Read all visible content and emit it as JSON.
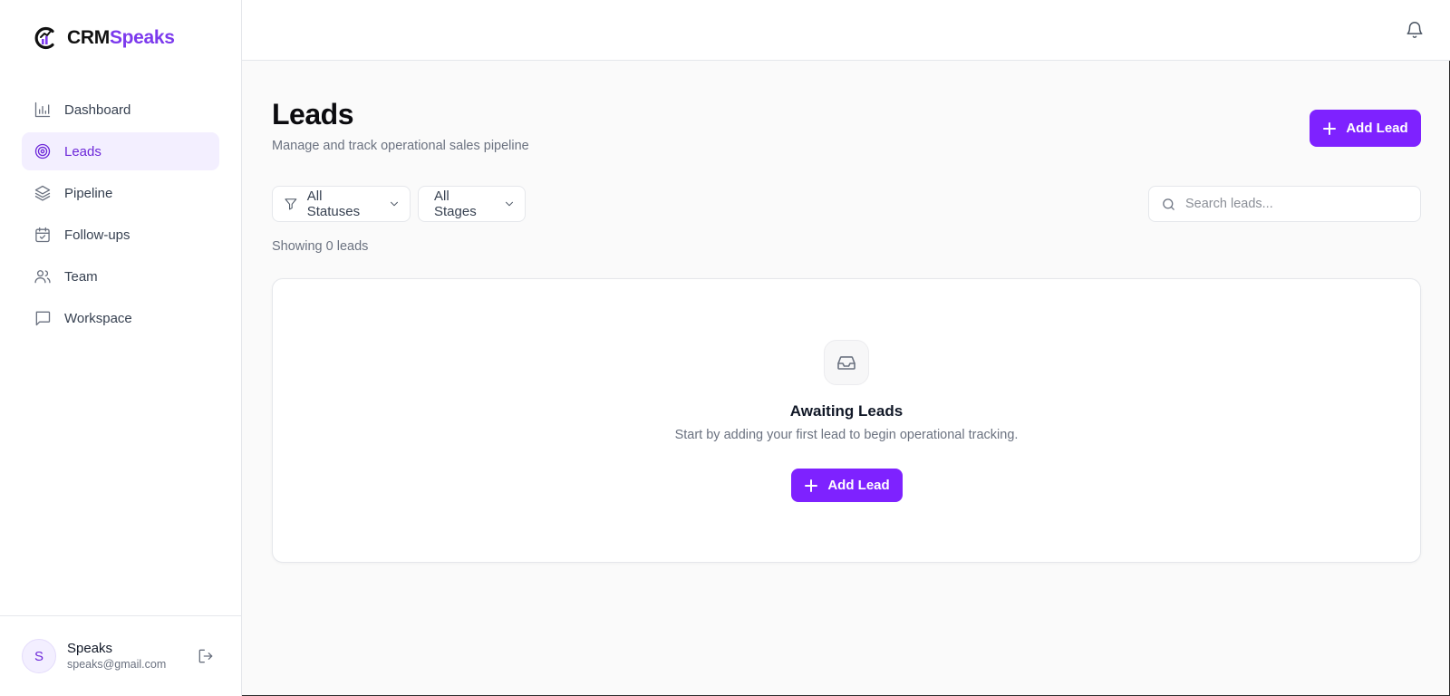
{
  "brand": {
    "name_part1": "CRM",
    "name_part2": "Speaks",
    "accent": "#7c3aed"
  },
  "nav": {
    "items": [
      {
        "label": "Dashboard",
        "icon": "bar-chart-icon",
        "active": false
      },
      {
        "label": "Leads",
        "icon": "target-icon",
        "active": true
      },
      {
        "label": "Pipeline",
        "icon": "layers-icon",
        "active": false
      },
      {
        "label": "Follow-ups",
        "icon": "calendar-check-icon",
        "active": false
      },
      {
        "label": "Team",
        "icon": "users-icon",
        "active": false
      },
      {
        "label": "Workspace",
        "icon": "message-square-icon",
        "active": false
      }
    ]
  },
  "user": {
    "initial": "S",
    "name": "Speaks",
    "email": "speaks@gmail.com"
  },
  "topbar": {
    "notification_icon": "bell-icon"
  },
  "page": {
    "title": "Leads",
    "subtitle": "Manage and track operational sales pipeline",
    "add_button": "Add Lead"
  },
  "filters": {
    "status": {
      "selected": "All Statuses",
      "icon": "filter-icon"
    },
    "stage": {
      "selected": "All Stages"
    }
  },
  "search": {
    "placeholder": "Search leads...",
    "value": ""
  },
  "results": {
    "count_text": "Showing 0 leads"
  },
  "empty_state": {
    "icon": "inbox-icon",
    "title": "Awaiting Leads",
    "description": "Start by adding your first lead to begin operational tracking.",
    "button": "Add Lead"
  },
  "colors": {
    "primary": "#7e22ff",
    "active_bg": "#f3efff",
    "active_text": "#6d28d9"
  }
}
